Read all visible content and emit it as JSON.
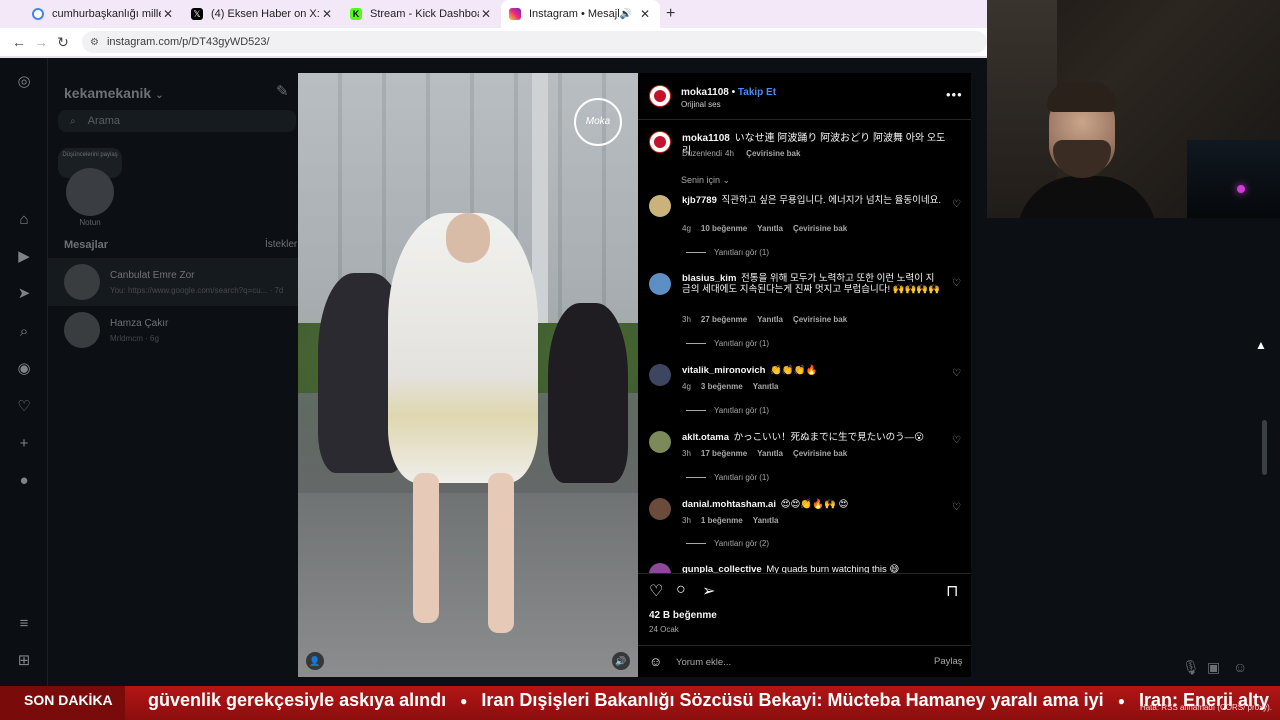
{
  "browser": {
    "tabs": [
      {
        "title": "cumhurbaşkanlığı millet kütüph...",
        "color": "#1a73e8",
        "active": false
      },
      {
        "title": "(4) Eksen Haber on X: \"Bir vatan...",
        "color": "#000000",
        "active": false
      },
      {
        "title": "Stream - Kick Dashboard",
        "color": "#53fc18",
        "active": false
      },
      {
        "title": "Instagram • Mesajlar",
        "color": "#d62976",
        "active": true
      }
    ],
    "url": "instagram.com/p/DT43gyWD523/"
  },
  "ig": {
    "username": "kekamekanik",
    "search_placeholder": "Arama",
    "note_bubble": "Düşüncelerini paylaş",
    "note_label": "Notun",
    "messages_title": "Mesajlar",
    "requests_link": "İstekler",
    "threads": [
      {
        "name": "Canbulat Emre Zor",
        "preview": "You: https://www.google.com/search?q=cu...",
        "time": "7d"
      },
      {
        "name": "Hamza Çakır",
        "preview": "Mrldmcm",
        "time": "6g"
      }
    ]
  },
  "video": {
    "logo_text": "Moka"
  },
  "post": {
    "author": "moka1108",
    "follow_label": "Takip Et",
    "audio": "Orijinal ses",
    "caption": "いなせ連 阿波踊り 阿波おどり 阿波舞 아와 오도리",
    "caption_edited": "Düzenlendi",
    "caption_time": "4h",
    "translate_label": "Çevirisine bak",
    "filter_label": "Senin için",
    "comments": [
      {
        "user": "kjb7789",
        "text": "직관하고 싶은 무용입니다. 에너지가 넘치는 율동이네요.",
        "time": "4g",
        "likes": "10 beğenme",
        "reply": "Yanıtla",
        "translate": "Çevirisine bak",
        "replies": "Yanıtları gör (1)"
      },
      {
        "user": "blasius_kim",
        "text": "전통을 위해 모두가 노력하고 또한 이런 노력이 지금의 세대에도 지속된다는게 진짜 멋지고 부럽습니다! 🙌🙌🙌🙌",
        "time": "3h",
        "likes": "27 beğenme",
        "reply": "Yanıtla",
        "translate": "Çevirisine bak",
        "replies": "Yanıtları gör (1)"
      },
      {
        "user": "vitalik_mironovich",
        "text": "👏👏👏🔥",
        "time": "4g",
        "likes": "3 beğenme",
        "reply": "Yanıtla",
        "translate": "",
        "replies": "Yanıtları gör (1)"
      },
      {
        "user": "aklt.otama",
        "text": "かっこいい！死ぬまでに生で見たいのう―😮",
        "time": "3h",
        "likes": "17 beğenme",
        "reply": "Yanıtla",
        "translate": "Çevirisine bak",
        "replies": "Yanıtları gör (1)"
      },
      {
        "user": "danial.mohtasham.ai",
        "text": "😍😍👏🔥🙌 😍",
        "time": "3h",
        "likes": "1 beğenme",
        "reply": "Yanıtla",
        "translate": "",
        "replies": "Yanıtları gör (2)"
      },
      {
        "user": "gunpla_collective",
        "text": "My quads burn watching this 😄",
        "time": "",
        "likes": "",
        "reply": "",
        "translate": "",
        "replies": ""
      }
    ],
    "likes_count": "42 B beğenme",
    "date": "24 Ocak",
    "comment_placeholder": "Yorum ekle...",
    "post_button": "Paylaş"
  },
  "ticker": {
    "label": "SON DAKİKA",
    "items": [
      "güvenlik gerekçesiyle askıya alındı",
      "Iran Dışişleri Bakanlığı Sözcüsü Bekayi: Mücteba Hamaney yaralı ama iyi",
      "Iran: Enerji alty"
    ],
    "rss_note": "Hata: RSS alınamadı (CORS/ proxy)."
  },
  "colors": {
    "accent_blue": "#4a8cf6",
    "ticker_red": "#b31515",
    "panel_bg": "#000000"
  },
  "icons": [
    "instagram-icon",
    "home-icon",
    "reels-icon",
    "send-icon",
    "search-icon",
    "explore-icon",
    "heart-icon",
    "create-icon",
    "profile-icon",
    "menu-icon",
    "meta-icon",
    "like-icon",
    "comment-icon",
    "share-icon",
    "bookmark-icon",
    "emoji-icon",
    "mic-icon",
    "image-icon",
    "sticker-icon"
  ]
}
